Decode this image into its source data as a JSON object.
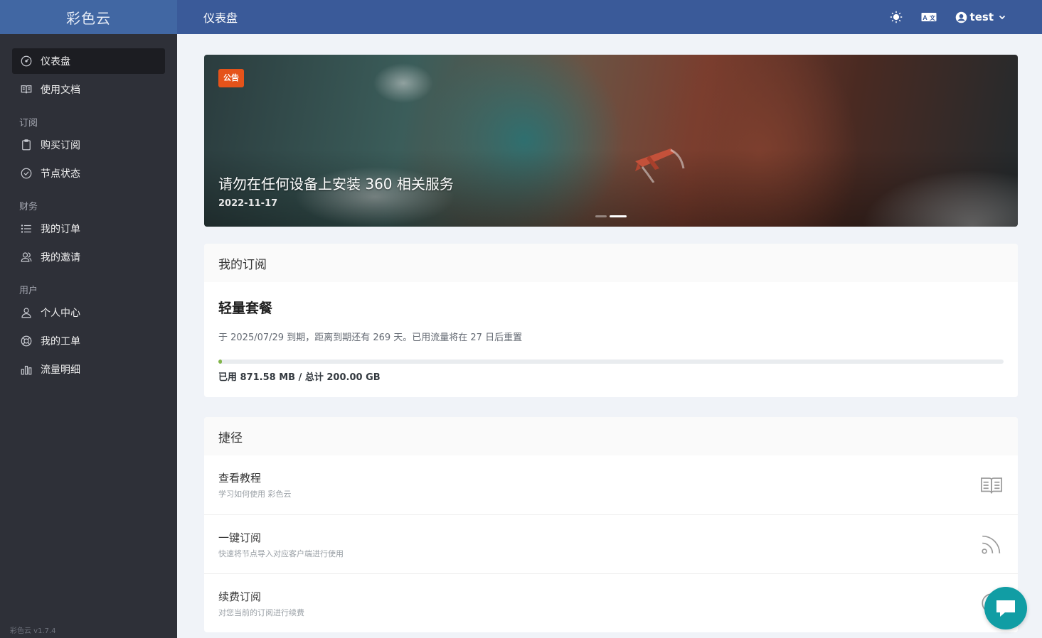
{
  "app": {
    "brand": "彩色云",
    "version": "彩色云 v1.7.4"
  },
  "header": {
    "title": "仪表盘",
    "username": "test"
  },
  "sidebar": {
    "top": [
      {
        "label": "仪表盘",
        "icon": "dashboard-icon",
        "active": true
      },
      {
        "label": "使用文档",
        "icon": "book-icon"
      }
    ],
    "groups": [
      {
        "title": "订阅",
        "items": [
          {
            "label": "购买订阅",
            "icon": "clipboard-icon"
          },
          {
            "label": "节点状态",
            "icon": "check-circle-icon"
          }
        ]
      },
      {
        "title": "财务",
        "items": [
          {
            "label": "我的订单",
            "icon": "list-icon"
          },
          {
            "label": "我的邀请",
            "icon": "users-icon"
          }
        ]
      },
      {
        "title": "用户",
        "items": [
          {
            "label": "个人中心",
            "icon": "user-icon"
          },
          {
            "label": "我的工单",
            "icon": "lifebuoy-icon"
          },
          {
            "label": "流量明细",
            "icon": "bar-chart-icon"
          }
        ]
      }
    ]
  },
  "banner": {
    "badge": "公告",
    "title": "请勿在任何设备上安装 360 相关服务",
    "date": "2022-11-17",
    "slides": 2,
    "active_slide": 2
  },
  "subscription": {
    "heading": "我的订阅",
    "plan": "轻量套餐",
    "info": "于 2025/07/29 到期，距离到期还有 269 天。已用流量将在 27 日后重置",
    "usage": "已用 871.58 MB / 总计 200.00 GB",
    "progress": 0.0043,
    "progress_color": "#82b54b"
  },
  "shortcuts": {
    "heading": "捷径",
    "items": [
      {
        "title": "查看教程",
        "desc": "学习如何使用 彩色云",
        "icon": "book-icon"
      },
      {
        "title": "一键订阅",
        "desc": "快速将节点导入对应客户端进行使用",
        "icon": "rss-icon"
      },
      {
        "title": "续费订阅",
        "desc": "对您当前的订阅进行续费",
        "icon": "circle-icon"
      }
    ]
  },
  "colors": {
    "header": "#3a5a99",
    "brand_bg": "#4167a3",
    "sidebar": "#2e3038",
    "badge": "#e5531a",
    "chat": "#119da4"
  }
}
